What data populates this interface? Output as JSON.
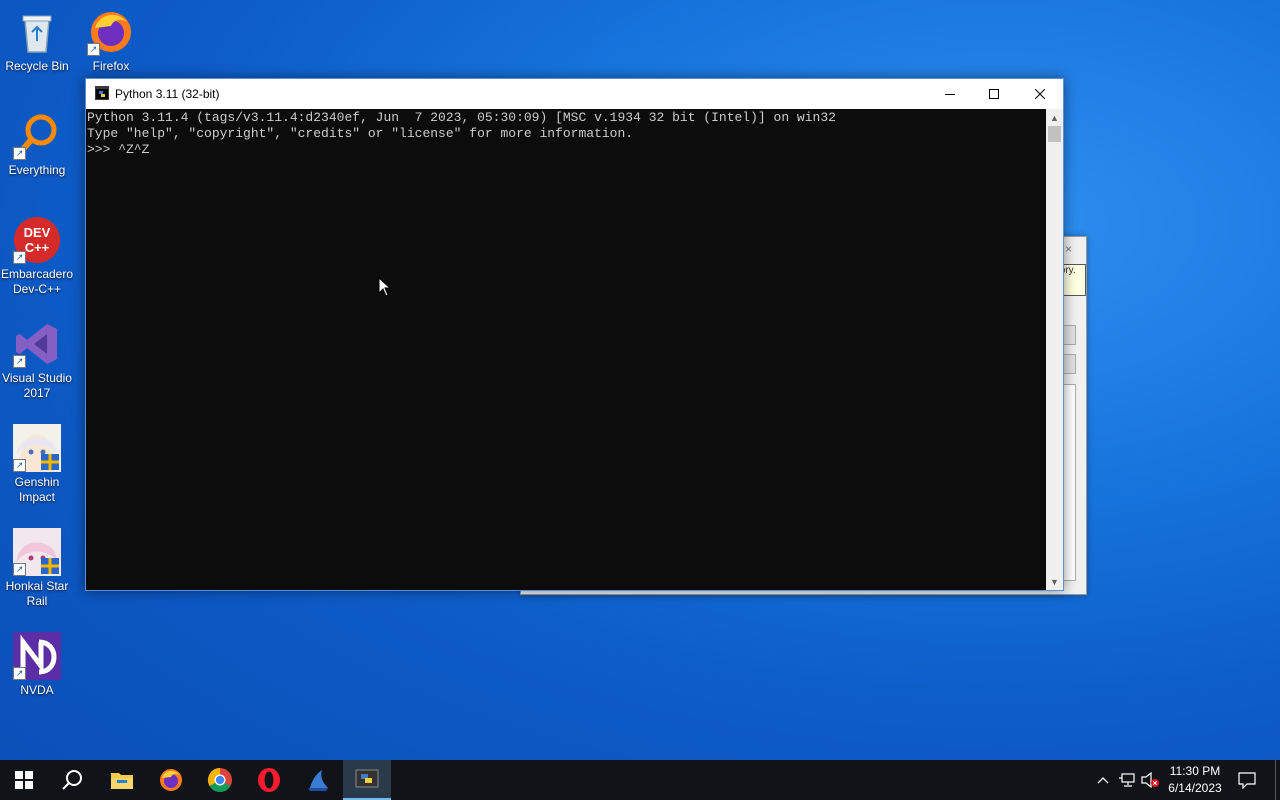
{
  "desktop": {
    "icons": [
      {
        "label": "Recycle Bin",
        "icon": "recycle-bin-icon"
      },
      {
        "label": "Firefox",
        "icon": "firefox-icon"
      },
      {
        "label": "Everything",
        "icon": "everything-search-icon"
      },
      {
        "label": "Embarcadero Dev-C++",
        "icon": "devcpp-icon",
        "icon_text": "DEV C++"
      },
      {
        "label": "Visual Studio 2017",
        "icon": "visual-studio-icon"
      },
      {
        "label": "Genshin Impact",
        "icon": "genshin-icon"
      },
      {
        "label": "Honkai Star Rail",
        "icon": "honkai-icon"
      },
      {
        "label": "NVDA",
        "icon": "nvda-icon"
      }
    ]
  },
  "background_dialog": {
    "close_glyph": "×",
    "tooltip_text": "tory."
  },
  "console": {
    "title": "Python 3.11 (32-bit)",
    "lines": [
      "Python 3.11.4 (tags/v3.11.4:d2340ef, Jun  7 2023, 05:30:09) [MSC v.1934 32 bit (Intel)] on win32",
      "Type \"help\", \"copyright\", \"credits\" or \"license\" for more information.",
      ">>> ^Z^Z"
    ],
    "colors": {
      "background": "#0c0c0c",
      "text": "#cccccc"
    }
  },
  "taskbar": {
    "apps": [
      "start-icon",
      "search-icon",
      "file-explorer-icon",
      "firefox-icon",
      "chrome-icon",
      "opera-icon",
      "app-icon",
      "python-icon"
    ],
    "active_app": "python-icon",
    "clock": {
      "time": "11:30 PM",
      "date": "6/14/2023"
    },
    "tray": [
      "show-hidden-icons-chevron",
      "network-icon",
      "volume-muted-icon",
      "notification-icon"
    ]
  }
}
